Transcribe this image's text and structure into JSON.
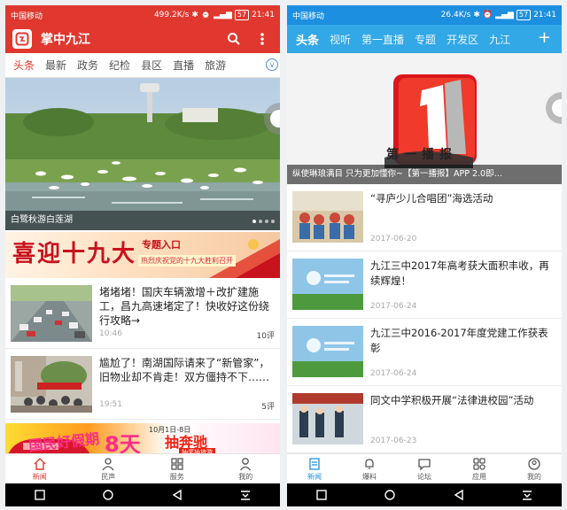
{
  "left": {
    "status": {
      "carrier": "中国移动",
      "speed": "499.2K/s",
      "battery": "57",
      "time": "21:41"
    },
    "app_title": "掌中九江",
    "tabs": [
      "头条",
      "最新",
      "政务",
      "纪检",
      "县区",
      "直播",
      "旅游"
    ],
    "hero_caption": "白鹭秋游白莲湖",
    "banner": {
      "title": "喜迎十九大",
      "entry": "专题入口",
      "slogan": "热烈庆祝党的十九大胜利召开"
    },
    "news": [
      {
        "title": "堵堵堵！国庆车辆激增＋改扩建施工，昌九高速堵定了！快收好这份绕行攻略→",
        "time": "10:46",
        "comments": "10评"
      },
      {
        "title": "尴尬了！南湖国际请来了“新管家”，旧物业却不肯走！双方僵持不下……",
        "time": "19:51",
        "comments": "5评"
      }
    ],
    "ad": {
      "t1": "国民好假期",
      "t2": "8天",
      "t3": "10月1日-8日",
      "t4": "抽奔驰",
      "t5": "抽奖抽旅游"
    },
    "bottom_nav": [
      "新闻",
      "民声",
      "服务",
      "我的"
    ]
  },
  "right": {
    "status": {
      "carrier": "中国移动",
      "speed": "26.4K/s",
      "battery": "57",
      "time": "21:41"
    },
    "tabs": [
      "头条",
      "视听",
      "第一直播",
      "专题",
      "开发区",
      "九江"
    ],
    "hero_logo_text": "第一播报",
    "hero_caption": "纵使琳琅满目 只为更加懂你~【第一播报】APP 2.0即…",
    "news": [
      {
        "title": "“寻庐少儿合唱团”海选活动",
        "date": "2017-06-20"
      },
      {
        "title": "九江三中2017年高考获大面积丰收，再续辉煌！",
        "date": "2017-06-24"
      },
      {
        "title": "九江三中2016-2017年度党建工作获表彰",
        "date": "2017-06-24"
      },
      {
        "title": "同文中学积极开展“法律进校园”活动",
        "date": "2017-06-23"
      }
    ],
    "bottom_nav": [
      "新闻",
      "爆料",
      "论坛",
      "应用",
      "我的"
    ]
  }
}
